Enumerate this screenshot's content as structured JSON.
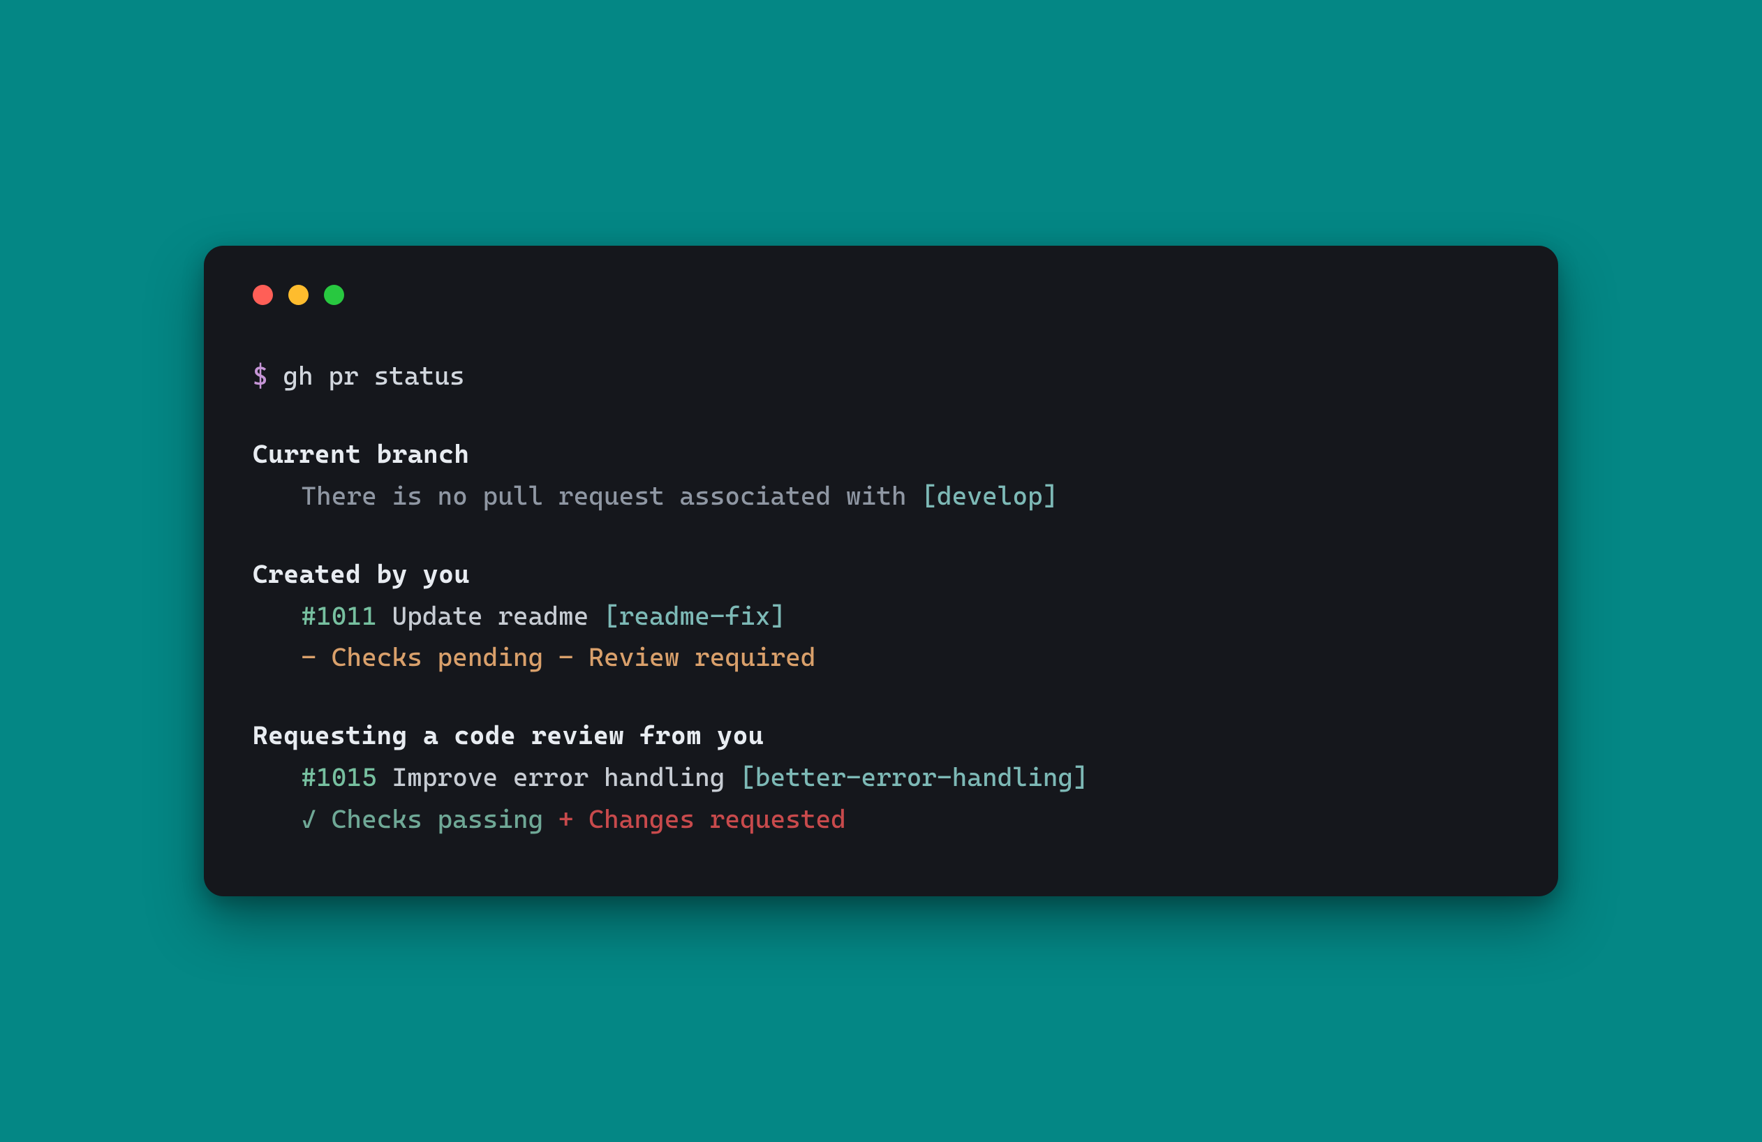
{
  "prompt": {
    "symbol": "$",
    "command": "gh pr status"
  },
  "sections": {
    "current_branch": {
      "heading": "Current branch",
      "message_prefix": "There is no pull request associated with ",
      "branch": "[develop]"
    },
    "created": {
      "heading": "Created by you",
      "pr": {
        "number": "#1011",
        "title": "Update readme",
        "branch": "[readme-fix]"
      },
      "status": "- Checks pending - Review required"
    },
    "requesting": {
      "heading": "Requesting a code review from you",
      "pr": {
        "number": "#1015",
        "title": "Improve error handling",
        "branch": "[better-error-handling]"
      },
      "checks": "✓ Checks passing",
      "review_sep": " + ",
      "review": "Changes requested"
    }
  }
}
